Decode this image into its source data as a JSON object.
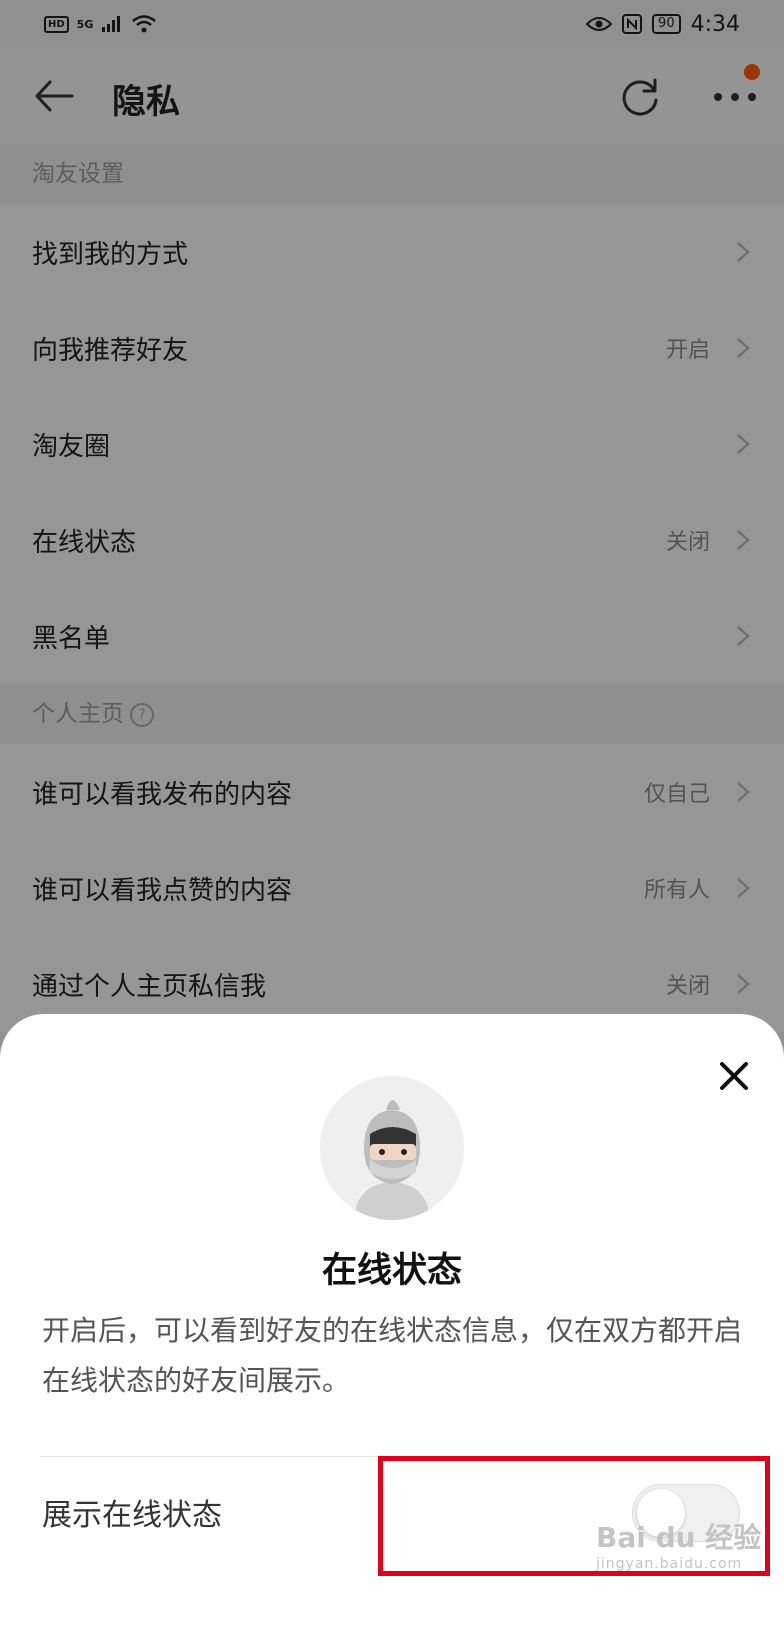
{
  "status_bar": {
    "left_badge": "HD",
    "network": "5G",
    "battery": "90",
    "time": "4:34"
  },
  "appbar": {
    "title": "隐私"
  },
  "sections": [
    {
      "header": "淘友设置",
      "items": [
        {
          "label": "找到我的方式",
          "value": ""
        },
        {
          "label": "向我推荐好友",
          "value": "开启"
        },
        {
          "label": "淘友圈",
          "value": ""
        },
        {
          "label": "在线状态",
          "value": "关闭"
        },
        {
          "label": "黑名单",
          "value": ""
        }
      ]
    },
    {
      "header": "个人主页",
      "items": [
        {
          "label": "谁可以看我发布的内容",
          "value": "仅自己"
        },
        {
          "label": "谁可以看我点赞的内容",
          "value": "所有人"
        },
        {
          "label": "通过个人主页私信我",
          "value": "关闭"
        }
      ]
    }
  ],
  "sheet": {
    "title": "在线状态",
    "description": "开启后，可以看到好友的在线状态信息，仅在双方都开启在线状态的好友间展示。",
    "toggle_label": "展示在线状态",
    "toggle_on": false
  },
  "watermark": {
    "text": "Bai du 经验",
    "sub": "jingyan.baidu.com"
  },
  "colors": {
    "accent_dot": "#ff5a00",
    "highlight": "#e0001a"
  }
}
